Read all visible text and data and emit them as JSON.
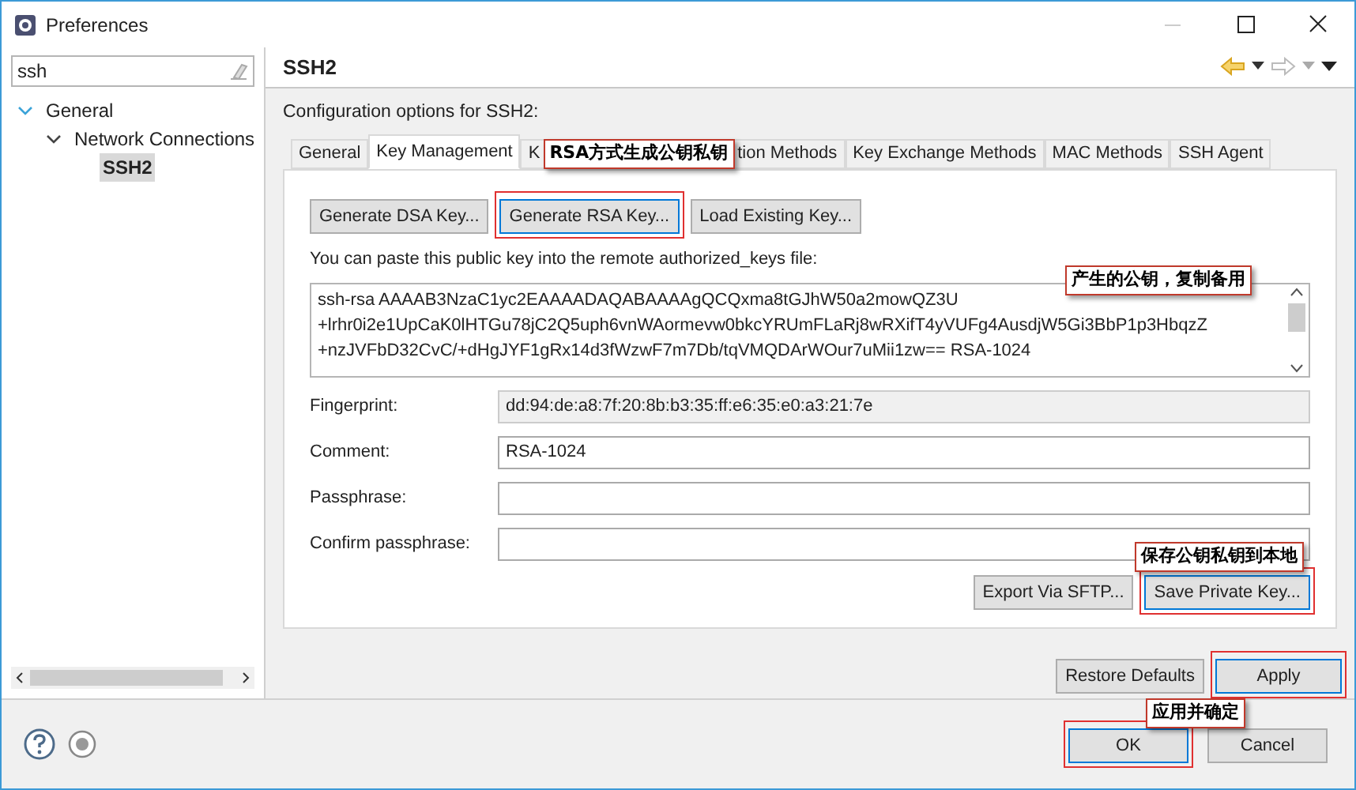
{
  "window": {
    "title": "Preferences"
  },
  "sidebar": {
    "filter": "ssh",
    "tree": [
      {
        "label": "General",
        "expanded": true,
        "selected": false,
        "children": [
          {
            "label": "Network Connections",
            "expanded": true,
            "selected": false,
            "children": [
              {
                "label": "SSH2",
                "selected": true
              }
            ]
          }
        ]
      }
    ]
  },
  "page": {
    "title": "SSH2",
    "description": "Configuration options for SSH2:"
  },
  "tabs": [
    {
      "label": "General",
      "selected": false
    },
    {
      "label": "Key Management",
      "selected": true
    },
    {
      "label": "K",
      "label_end": "tion Methods",
      "selected": false
    },
    {
      "label": "Key Exchange Methods",
      "selected": false
    },
    {
      "label": "MAC Methods",
      "selected": false
    },
    {
      "label": "SSH Agent",
      "selected": false
    }
  ],
  "key_buttons": [
    {
      "label": "Generate DSA Key...",
      "highlighted": false
    },
    {
      "label": "Generate RSA Key...",
      "highlighted": true
    },
    {
      "label": "Load Existing Key...",
      "highlighted": false
    }
  ],
  "public_key_label": "You can paste this public key into the remote authorized_keys file:",
  "public_key": [
    "ssh-rsa AAAAB3NzaC1yc2EAAAADAQABAAAAgQCQxma8tGJhW50a2mowQZ3U",
    "+lrhr0i2e1UpCaK0lHTGu78jC2Q5uph6vnWAormevw0bkcYRUmFLaRj8wRXifT4yVUFg4AusdjW5Gi3BbP1p3HbqzZ",
    "+nzJVFbD32CvC/+dHgJYF1gRx14d3fWzwF7m7Db/tqVMQDArWOur7uMii1zw== RSA-1024"
  ],
  "fields": [
    {
      "label": "Fingerprint:",
      "value": "dd:94:de:a8:7f:20:8b:b3:35:ff:e6:35:e0:a3:21:7e",
      "disabled": true
    },
    {
      "label": "Comment:",
      "value": "RSA-1024",
      "disabled": false
    },
    {
      "label": "Passphrase:",
      "disabled": false
    },
    {
      "label": "Confirm passphrase:",
      "disabled": false
    }
  ],
  "export_buttons": [
    {
      "label": "Export Via SFTP...",
      "highlighted": false
    },
    {
      "label": "Save Private Key...",
      "highlighted": true
    }
  ],
  "page_buttons": [
    {
      "label": "Restore Defaults",
      "highlighted": false
    },
    {
      "label": "Apply",
      "highlighted": true
    }
  ],
  "dialog_buttons": [
    {
      "label": "OK",
      "highlighted": true
    },
    {
      "label": "Cancel",
      "highlighted": false
    }
  ],
  "annotations": [
    "RSA方式生成公钥私钥",
    "产生的公钥，复制备用",
    "保存公钥私钥到本地",
    "应用并确定"
  ]
}
